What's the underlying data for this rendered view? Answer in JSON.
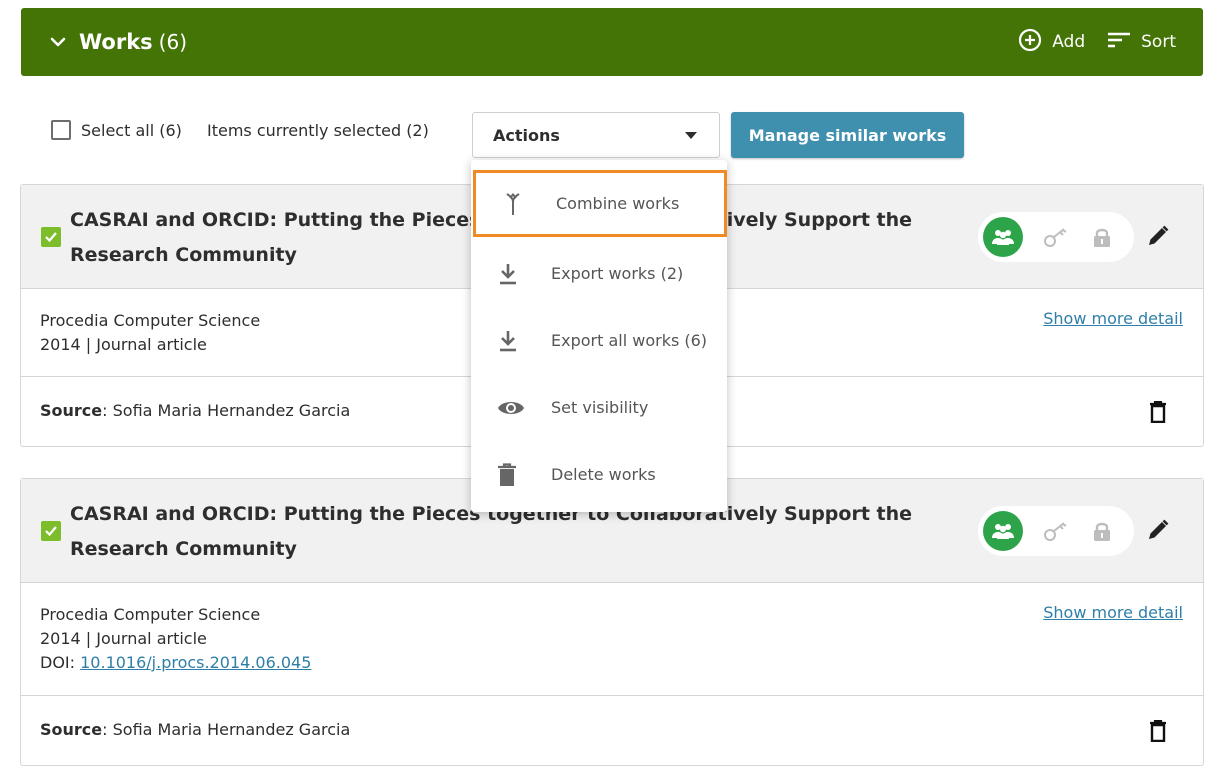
{
  "header": {
    "title": "Works",
    "count": "(6)",
    "add_label": "Add",
    "sort_label": "Sort",
    "bg_color": "#447405"
  },
  "toolbar": {
    "select_all_label": "Select all (6)",
    "items_selected_label": "Items currently selected (2)",
    "actions_label": "Actions",
    "manage_label": "Manage similar works"
  },
  "actions_menu": {
    "items": [
      {
        "label": "Combine works",
        "icon": "merge-icon",
        "highlighted": true
      },
      {
        "label": "Export works (2)",
        "icon": "download-icon"
      },
      {
        "label": "Export all works (6)",
        "icon": "download-icon"
      },
      {
        "label": "Set visibility",
        "icon": "eye-icon"
      },
      {
        "label": "Delete works",
        "icon": "trash-icon"
      }
    ]
  },
  "works": [
    {
      "title": "CASRAI and ORCID: Putting the Pieces together to Collaboratively Support the Research Community",
      "journal": "Procedia Computer Science",
      "year_type": "2014 | Journal article",
      "show_more": "Show more detail",
      "source_label": "Source",
      "source_value": "Sofia Maria Hernandez Garcia",
      "selected": true
    },
    {
      "title": "CASRAI and ORCID: Putting the Pieces together to Collaboratively Support the Research Community",
      "journal": "Procedia Computer Science",
      "year_type": "2014 | Journal article",
      "doi_label": "DOI:",
      "doi_value": "10.1016/j.procs.2014.06.045",
      "show_more": "Show more detail",
      "source_label": "Source",
      "source_value": "Sofia Maria Hernandez Garcia",
      "selected": true
    }
  ]
}
